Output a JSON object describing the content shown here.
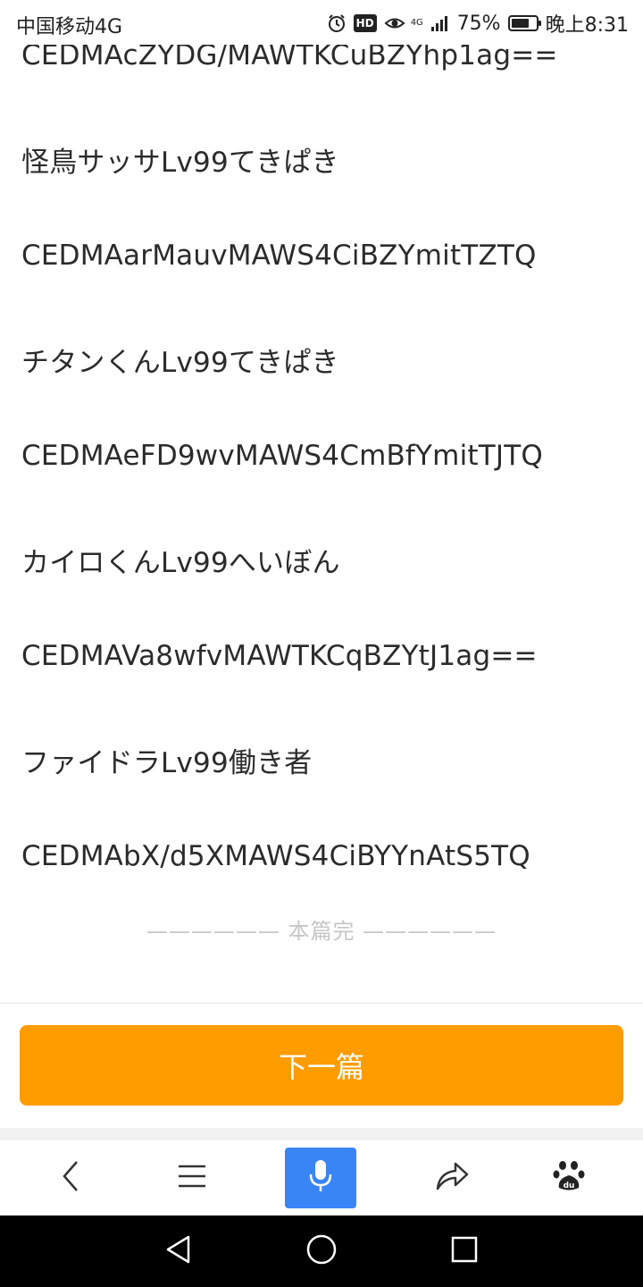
{
  "status_bar": {
    "carrier": "中国移动4G",
    "network_label": "4G",
    "battery_percent": "75%",
    "battery_level": 0.75,
    "time": "晚上8:31",
    "hd_badge": "HD"
  },
  "article": {
    "lines": [
      "CEDMAcZYDG/MAWTKCuBZYhp1ag==",
      "怪鳥サッサLv99てきぱき",
      "CEDMAarMauvMAWS4CiBZYmitTZTQ",
      "チタンくんLv99てきぱき",
      "CEDMAeFD9wvMAWS4CmBfYmitTJTQ",
      "カイロくんLv99へいぼん",
      "CEDMAVa8wfvMAWTKCqBZYtJ1ag==",
      "ファイドラLv99働き者",
      "CEDMAbX/d5XMAWS4CiBYYnAtS5TQ"
    ],
    "end_marker": "—————— 本篇完 ——————"
  },
  "next_button": {
    "label": "下一篇"
  },
  "toolbar": {
    "icons": [
      "back-icon",
      "menu-icon",
      "microphone-icon",
      "share-icon",
      "baidu-paw-icon"
    ]
  },
  "nav": {
    "icons": [
      "nav-back-icon",
      "nav-home-icon",
      "nav-recents-icon"
    ]
  },
  "colors": {
    "accent_orange": "#ff9c00",
    "mic_blue": "#3a85f5"
  }
}
